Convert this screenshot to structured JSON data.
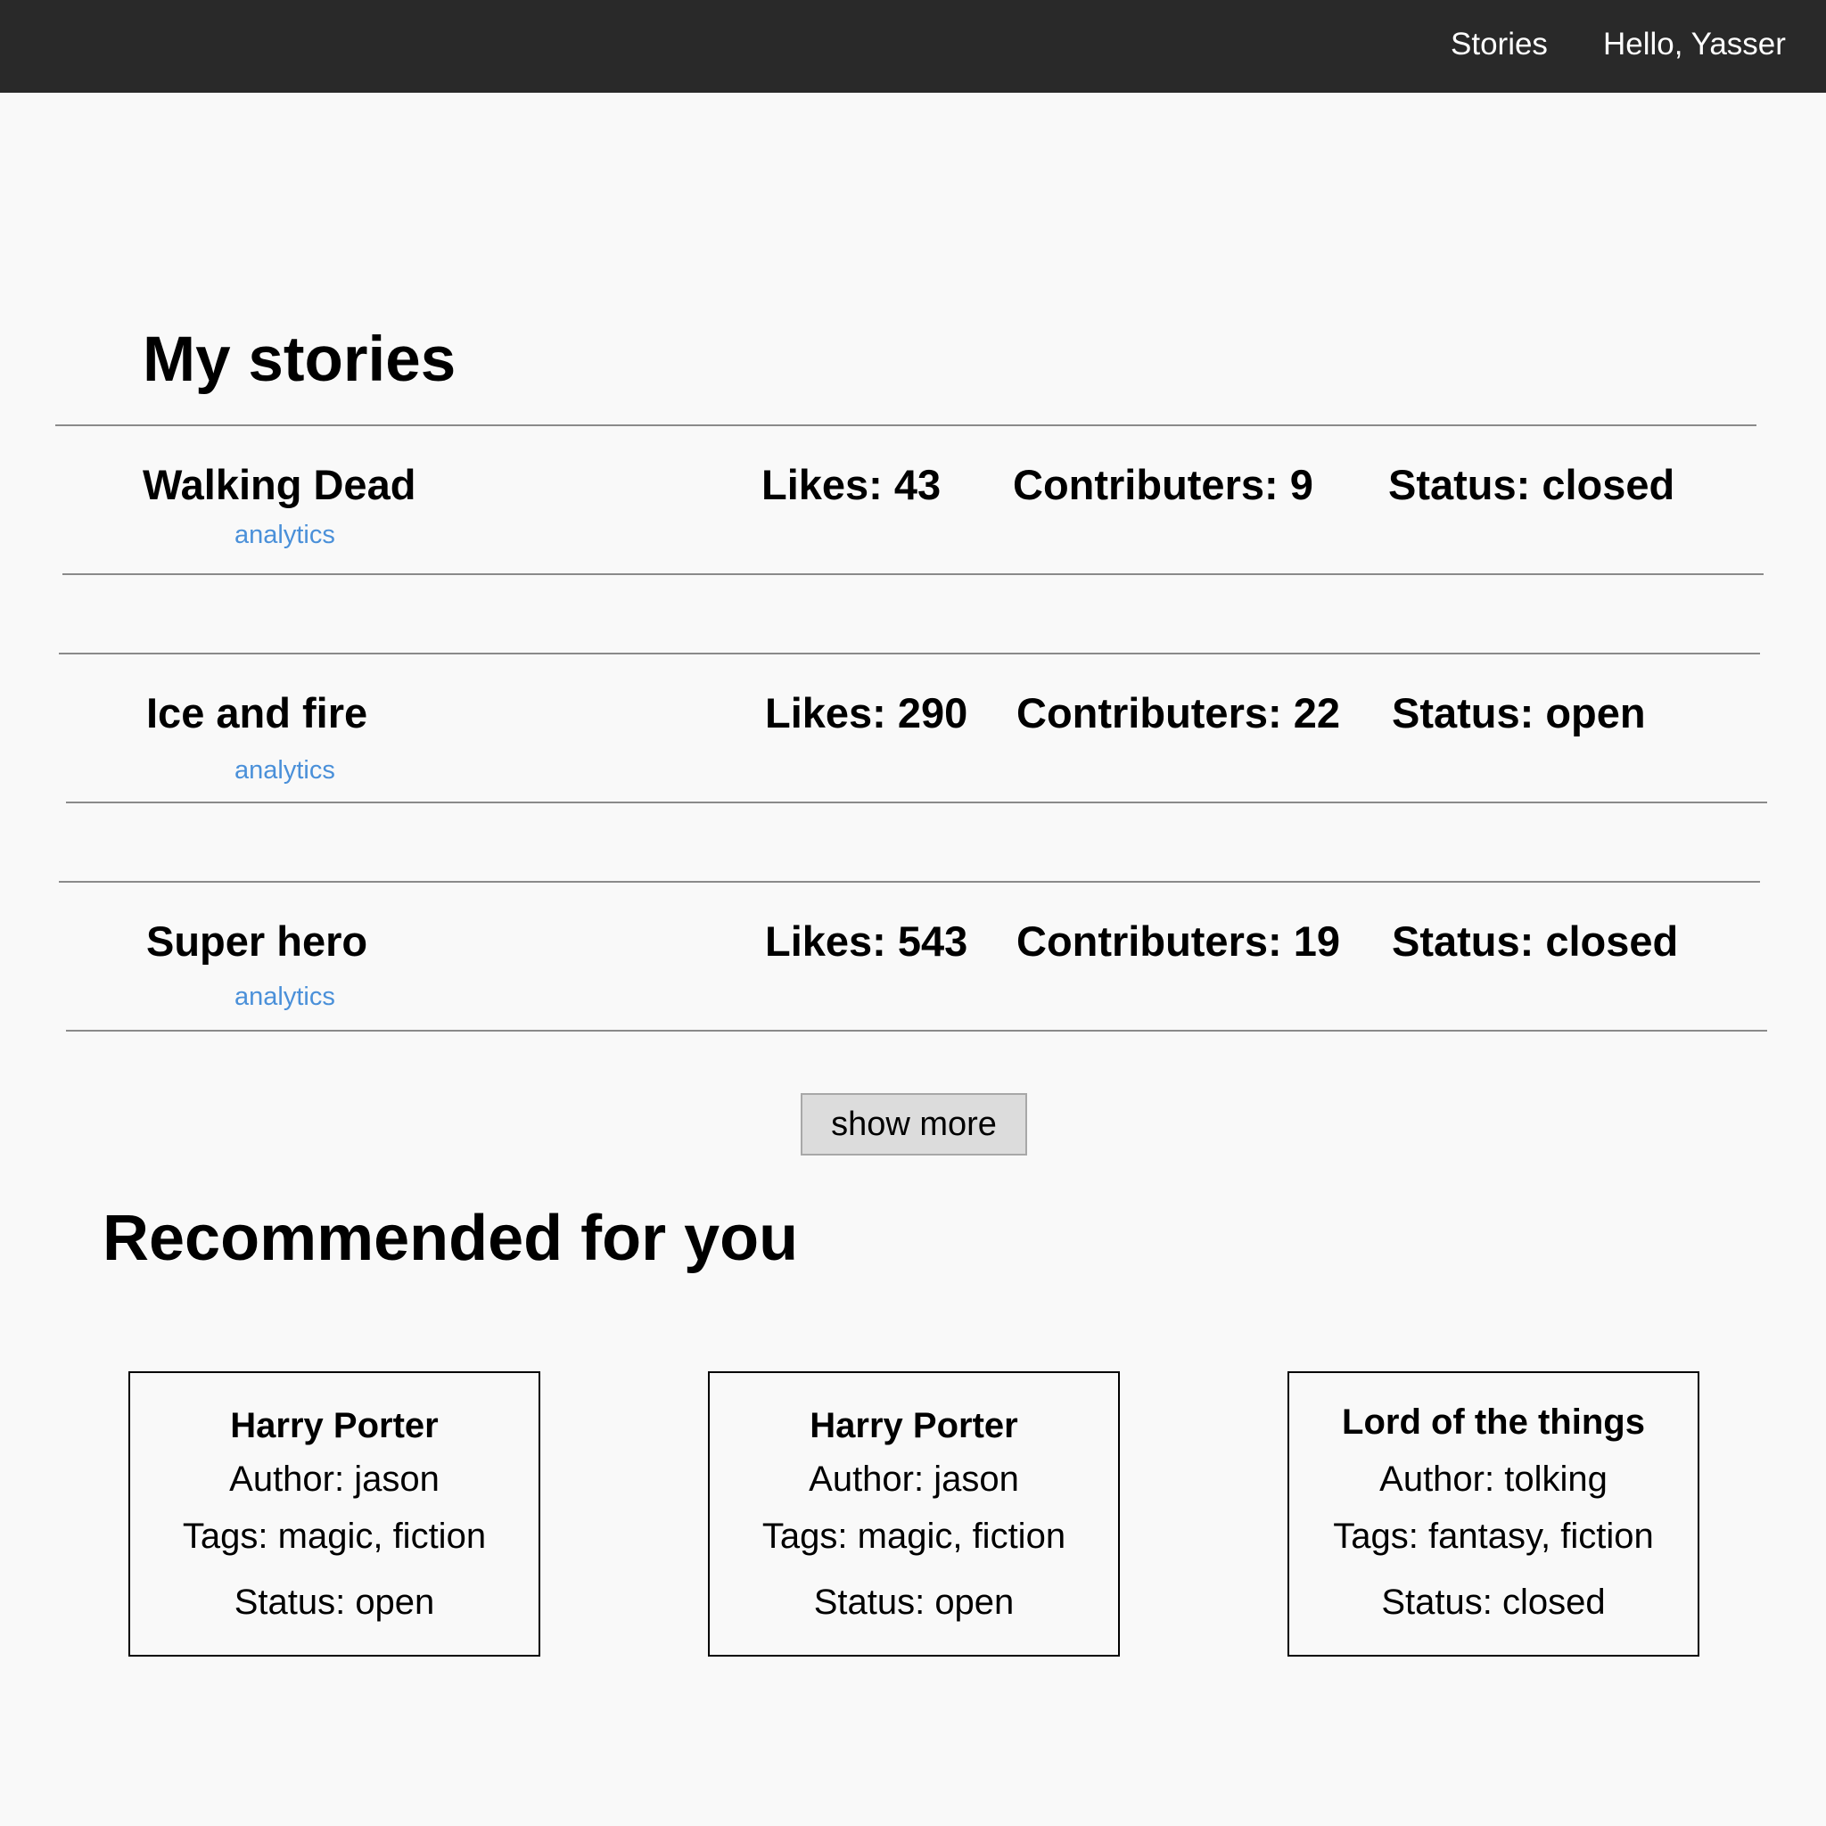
{
  "nav": {
    "stories_label": "Stories",
    "greeting": "Hello, Yasser"
  },
  "my_stories": {
    "title": "My stories",
    "items": [
      {
        "title": "Walking Dead",
        "likes": "Likes: 43",
        "contributors": "Contributers: 9",
        "status": "Status: closed",
        "analytics_label": "analytics"
      },
      {
        "title": "Ice and fire",
        "likes": "Likes: 290",
        "contributors": "Contributers: 22",
        "status": "Status: open",
        "analytics_label": "analytics"
      },
      {
        "title": "Super hero",
        "likes": "Likes: 543",
        "contributors": "Contributers: 19",
        "status": "Status: closed",
        "analytics_label": "analytics"
      }
    ],
    "show_more_label": "show more"
  },
  "recommended": {
    "title": "Recommended for you",
    "cards": [
      {
        "title": "Harry Porter",
        "author": "Author: jason",
        "tags": "Tags: magic, fiction",
        "status": "Status: open"
      },
      {
        "title": "Harry Porter",
        "author": "Author: jason",
        "tags": "Tags: magic, fiction",
        "status": "Status: open"
      },
      {
        "title": "Lord of the things",
        "author": "Author: tolking",
        "tags": "Tags: fantasy, fiction",
        "status": "Status: closed"
      }
    ]
  },
  "colors": {
    "navbar_bg": "#292929",
    "page_bg": "#f9f9f9",
    "link": "#4a90d9",
    "button_bg": "#dcdcdc"
  }
}
